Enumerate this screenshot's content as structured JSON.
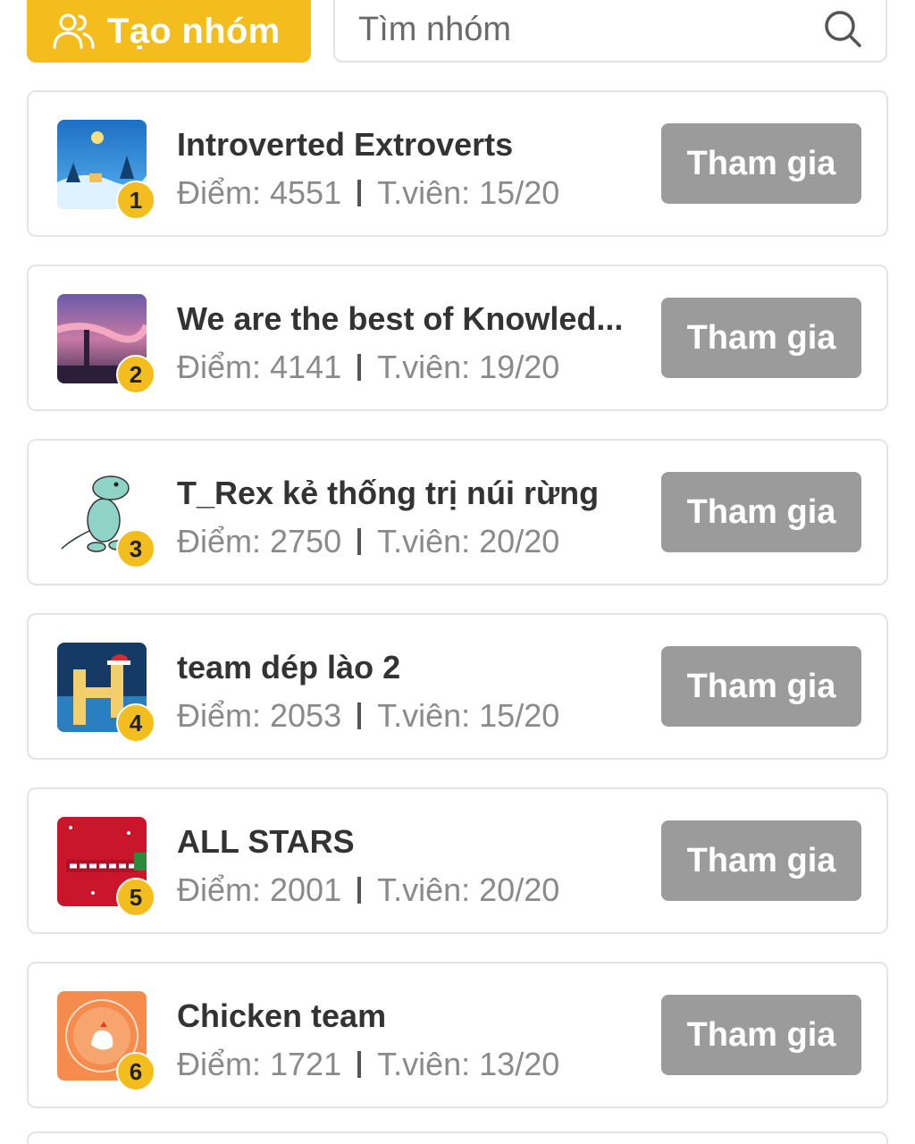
{
  "header": {
    "create_group_label": "Tạo nhóm",
    "search_placeholder": "Tìm nhóm"
  },
  "icons": {
    "create": "users-icon",
    "search": "search-icon"
  },
  "colors": {
    "accent": "#f2bd1d",
    "join_button": "#9b9b9b"
  },
  "groups": [
    {
      "rank": "1",
      "name": "Introverted Extroverts",
      "score": "Điểm: 4551",
      "members": "T.viên: 15/20",
      "join_label": "Tham gia"
    },
    {
      "rank": "2",
      "name": "We are the best of Knowled...",
      "score": "Điểm: 4141",
      "members": "T.viên: 19/20",
      "join_label": "Tham gia"
    },
    {
      "rank": "3",
      "name": "T_Rex kẻ thống trị núi rừng",
      "score": "Điểm: 2750",
      "members": "T.viên: 20/20",
      "join_label": "Tham gia"
    },
    {
      "rank": "4",
      "name": "team dép lào 2",
      "score": "Điểm: 2053",
      "members": "T.viên: 15/20",
      "join_label": "Tham gia"
    },
    {
      "rank": "5",
      "name": "ALL STARS",
      "score": "Điểm: 2001",
      "members": "T.viên: 20/20",
      "join_label": "Tham gia"
    },
    {
      "rank": "6",
      "name": "Chicken team",
      "score": "Điểm: 1721",
      "members": "T.viên: 13/20",
      "join_label": "Tham gia"
    }
  ]
}
